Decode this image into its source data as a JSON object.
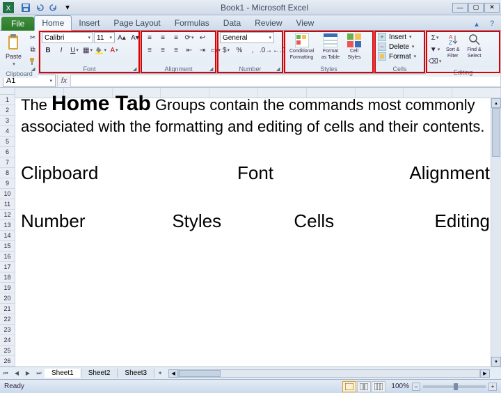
{
  "title": "Book1 - Microsoft Excel",
  "qat": {
    "save_tip": "Save",
    "undo_tip": "Undo",
    "redo_tip": "Redo"
  },
  "tabs": {
    "file": "File",
    "items": [
      "Home",
      "Insert",
      "Page Layout",
      "Formulas",
      "Data",
      "Review",
      "View"
    ],
    "active_index": 0
  },
  "ribbon": {
    "clipboard": {
      "paste": "Paste",
      "label": "Clipboard",
      "cut_tip": "Cut",
      "copy_tip": "Copy",
      "painter_tip": "Format Painter"
    },
    "font": {
      "name": "Calibri",
      "size": "11",
      "label": "Font"
    },
    "alignment": {
      "label": "Alignment"
    },
    "number": {
      "format": "General",
      "label": "Number"
    },
    "styles": {
      "cond": "Conditional",
      "cond2": "Formatting",
      "fmt": "Format",
      "fmt2": "as Table",
      "cell": "Cell",
      "cell2": "Styles",
      "label": "Styles"
    },
    "cells": {
      "insert": "Insert",
      "delete": "Delete",
      "format": "Format",
      "label": "Cells"
    },
    "editing": {
      "sort": "Sort &",
      "sort2": "Filter",
      "find": "Find &",
      "find2": "Select",
      "label": "Editing"
    }
  },
  "formula_bar": {
    "name_box": "A1",
    "fx": "fx"
  },
  "rows": [
    "1",
    "2",
    "3",
    "4",
    "5",
    "6",
    "7",
    "8",
    "9",
    "10",
    "11",
    "12",
    "13",
    "14",
    "15",
    "16",
    "17",
    "18",
    "19",
    "20",
    "21",
    "22",
    "23",
    "24",
    "25",
    "26"
  ],
  "overlay": {
    "para_pre": "The ",
    "para_bold": "Home Tab",
    "para_post": " Groups contain the commands most commonly associated with the formatting and editing of cells and their contents.",
    "g1": "Clipboard",
    "g2": "Font",
    "g3": "Alignment",
    "g4": "Number",
    "g5": "Styles",
    "g6": "Cells",
    "g7": "Editing"
  },
  "sheet_tabs": {
    "items": [
      "Sheet1",
      "Sheet2",
      "Sheet3"
    ],
    "active_index": 0
  },
  "status": {
    "ready": "Ready",
    "zoom": "100%"
  }
}
